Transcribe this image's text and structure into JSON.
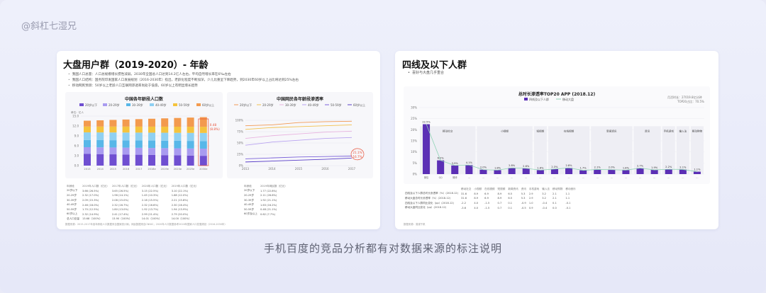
{
  "watermark": "@斜杠七湿兄",
  "caption": "手机百度的竞品分析都有对数据来源的标注说明",
  "left": {
    "title": "大盘用户群（2019-2020）- 年龄",
    "bullets": [
      "我国人口总量：人口总规模增长惯性减弱，2030年全国总人口达到14.2亿人左右，平均自然增长率在6‰左右",
      "我国人口结构：国务院印发国家人口发展规划（2016-2030年）指出，老龄化程度不断加深，少儿比重呈下降趋势，到2030年60岁以上占比将达到25%左右",
      "移动网民预测：50岁以上老龄人口互联网渗透率尚处于低值，60岁以上有明显增长趋势"
    ],
    "bar_title": "中国各年龄段人口数",
    "bar_unit": "单位：亿人",
    "bar_legend": [
      "20岁以下",
      "20-29岁",
      "30-39岁",
      "40-49岁",
      "50-59岁",
      "60岁以上"
    ],
    "bar_annot_1": "0.48",
    "bar_annot_2": "(8.8%)",
    "line_title": "中国网民各年龄段渗透率",
    "line_legend": [
      "20岁以下",
      "20-29岁",
      "30-39岁",
      "40-49岁",
      "50-59岁",
      "60岁以上"
    ],
    "line_annot_1": "21.1%",
    "line_annot_2": "16.7%",
    "table1_head": [
      "年龄段",
      "2019年人口数（亿元）",
      "2017年人口数（亿元）",
      "2020年人口数（亿元）",
      "2019年人口数（亿元）"
    ],
    "table1_rows": [
      [
        "20岁以下",
        "3.66 (26.5%)",
        "3.65 (26.5%)",
        "3.15 (22.5%)",
        "3.10 (22.1%)"
      ],
      [
        "20-29岁",
        "2.32 (17.0%)",
        "1.96 (14.1%)",
        "1.45 (10.3%)",
        "1.68 (12.0%)"
      ],
      [
        "30-39岁",
        "2.09 (15.3%)",
        "2.08 (15.0%)",
        "2.18 (15.5%)",
        "2.21 (15.8%)"
      ],
      [
        "40-49岁",
        "2.46 (18.0%)",
        "2.32 (16.7%)",
        "2.32 (16.6%)",
        "2.30 (16.4%)"
      ],
      [
        "50-59岁",
        "1.70 (12.5%)",
        "1.80 (13.0%)",
        "1.92 (13.7%)",
        "1.94 (13.9%)"
      ],
      [
        "60岁以上",
        "2.32 (14.9%)",
        "2.41 (17.4%)",
        "2.99 (21.4%)",
        "2.79 (20.0%)"
      ],
      [
        "总人口总量",
        "13.68（100%）",
        "13.90（100%）",
        "14.01（100%）",
        "14.00（100%）"
      ]
    ],
    "table2_head": [
      "年龄段",
      "2019年网民数（亿元）"
    ],
    "table2_rows": [
      [
        "20岁以下",
        "1.77 (22.8%)"
      ],
      [
        "20-29岁",
        "2.11 (26.6%)"
      ],
      [
        "30-39岁",
        "1.92 (21.1%)"
      ],
      [
        "40-49岁",
        "1.63 (16.2%)"
      ],
      [
        "50-59岁",
        "0.48 (21.1%)"
      ],
      [
        "60岁及以上",
        "0.62 (7.7%)"
      ]
    ],
    "footnote": "数据来源：2015-2017年各年龄段人口数据来自国家统计局；网民数据来自CNNIC；2020年人口数据参考2016年国家人口发展规划（2016-2030年）"
  },
  "right": {
    "title": "四线及以下人群",
    "subtitle": "喜好与大盘几乎重合",
    "chart_title": "总时长渗透率TOP20 APP (2018.12)",
    "legend_1": "四线及以下人群",
    "legend_2": "移动大盘",
    "note_1": "月活时长：27019.8亿分钟",
    "note_2": "TOP20占比：70.5%",
    "y_ticks": [
      "30%",
      "25%",
      "20%",
      "15%",
      "10%",
      "5%",
      "0%"
    ],
    "categories": [
      "微信",
      "QQ",
      "微博",
      "...",
      "...",
      "...",
      "...",
      "...",
      "...",
      "...",
      "...",
      "...",
      "...",
      "...",
      "...",
      "...",
      "...",
      "...",
      "...",
      "..."
    ],
    "group_labels": [
      "移动社交",
      "小视频",
      "短视频",
      "在线视频",
      "新闻资讯",
      "资讯",
      "手机游戏",
      "输入法",
      "移动购物",
      "移动音乐"
    ],
    "table_head": [
      "",
      "移动社交",
      "小视频",
      "在线视频",
      "短视频",
      "新闻资讯",
      "资讯",
      "手机游戏",
      "输入法",
      "移动购物",
      "移动音乐"
    ],
    "table_rows": [
      [
        "四线及以下人群总时长渗透率（%）(2018.12)",
        "31.6",
        "8.9",
        "6.9",
        "8.9",
        "6.5",
        "5.3",
        "2.9",
        "3.2",
        "2.1",
        "1.1"
      ],
      [
        "移动大盘总时长渗透率（%）(2018.12)",
        "31.6",
        "8.9",
        "6.9",
        "8.9",
        "6.5",
        "5.3",
        "2.9",
        "3.2",
        "2.1",
        "1.1"
      ],
      [
        "四线及以下人群同比变化（pp）(2018.12)",
        "-2.2",
        "4.0",
        "-1.5",
        "0.7",
        "0.1",
        "-0.9",
        "1.0",
        "-0.4",
        "0.1",
        "-0.1"
      ],
      [
        "移动大盘同比变化（pp）(2018.12)",
        "-3.6",
        "4.0",
        "-1.5",
        "0.7",
        "0.1",
        "-0.5",
        "0.9",
        "-0.4",
        "0.0",
        "-0.1"
      ]
    ],
    "footnote": "数据来源：易观千帆"
  },
  "chart_data": [
    {
      "type": "bar",
      "title": "中国各年龄段人口数",
      "ylabel": "单位：亿人",
      "categories": [
        "2013",
        "2014",
        "2015",
        "2016",
        "2017",
        "2018e",
        "2019e",
        "2020e",
        "2025e",
        "2030e"
      ],
      "series_names": [
        "20岁以下",
        "20-29岁",
        "30-39岁",
        "40-49岁",
        "50-59岁",
        "60岁以上"
      ],
      "colors": [
        "#6f4fd1",
        "#a99bf0",
        "#58b7e8",
        "#8fd0f2",
        "#f5c33d",
        "#f39a4e"
      ],
      "ylim": [
        0,
        15
      ]
    },
    {
      "type": "line",
      "title": "中国网民各年龄段渗透率",
      "categories": [
        "2013",
        "2014",
        "2015",
        "2016",
        "2017"
      ],
      "ylim": [
        0,
        100
      ]
    },
    {
      "type": "bar",
      "title": "总时长渗透率TOP20 APP (2018.12)",
      "series": [
        {
          "name": "四线及以下人群",
          "values": [
            22.5,
            6.2,
            3.9,
            4.1,
            2.0,
            1.8,
            2.8,
            2.6,
            1.8,
            2.3,
            2.8,
            1.7,
            2.1,
            2.0,
            1.8,
            2.7,
            1.9,
            2.2,
            2.1,
            1.1
          ]
        },
        {
          "name": "移动大盘",
          "values": [
            22.5,
            6.2,
            3.9,
            4.1,
            2.0,
            1.8,
            2.8,
            2.6,
            1.8,
            2.3,
            2.8,
            1.7,
            2.1,
            2.0,
            1.8,
            2.7,
            1.9,
            2.2,
            2.1,
            1.1
          ]
        }
      ],
      "ylim": [
        0,
        30
      ]
    }
  ]
}
